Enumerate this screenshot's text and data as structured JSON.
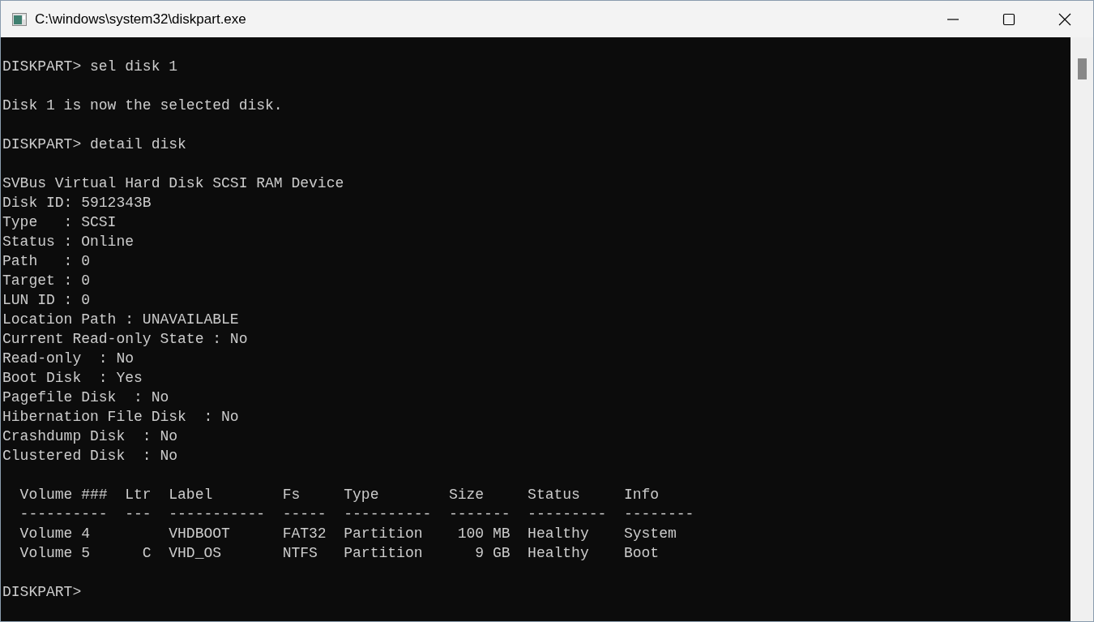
{
  "window": {
    "title": "C:\\windows\\system32\\diskpart.exe"
  },
  "console": {
    "blocks": [
      {
        "lines": [
          "DISKPART> sel disk 1"
        ]
      },
      {
        "lines": [
          "Disk 1 is now the selected disk."
        ]
      },
      {
        "lines": [
          "DISKPART> detail disk"
        ]
      },
      {
        "lines": [
          "SVBus Virtual Hard Disk SCSI RAM Device",
          "Disk ID: 5912343B",
          "Type   : SCSI",
          "Status : Online",
          "Path   : 0",
          "Target : 0",
          "LUN ID : 0",
          "Location Path : UNAVAILABLE",
          "Current Read-only State : No",
          "Read-only  : No",
          "Boot Disk  : Yes",
          "Pagefile Disk  : No",
          "Hibernation File Disk  : No",
          "Crashdump Disk  : No",
          "Clustered Disk  : No"
        ]
      },
      {
        "lines": [
          "  Volume ###  Ltr  Label        Fs     Type        Size     Status     Info",
          "  ----------  ---  -----------  -----  ----------  -------  ---------  --------",
          "  Volume 4         VHDBOOT      FAT32  Partition    100 MB  Healthy    System",
          "  Volume 5      C  VHD_OS       NTFS   Partition      9 GB  Healthy    Boot"
        ]
      },
      {
        "lines": [
          "DISKPART>"
        ]
      }
    ]
  }
}
